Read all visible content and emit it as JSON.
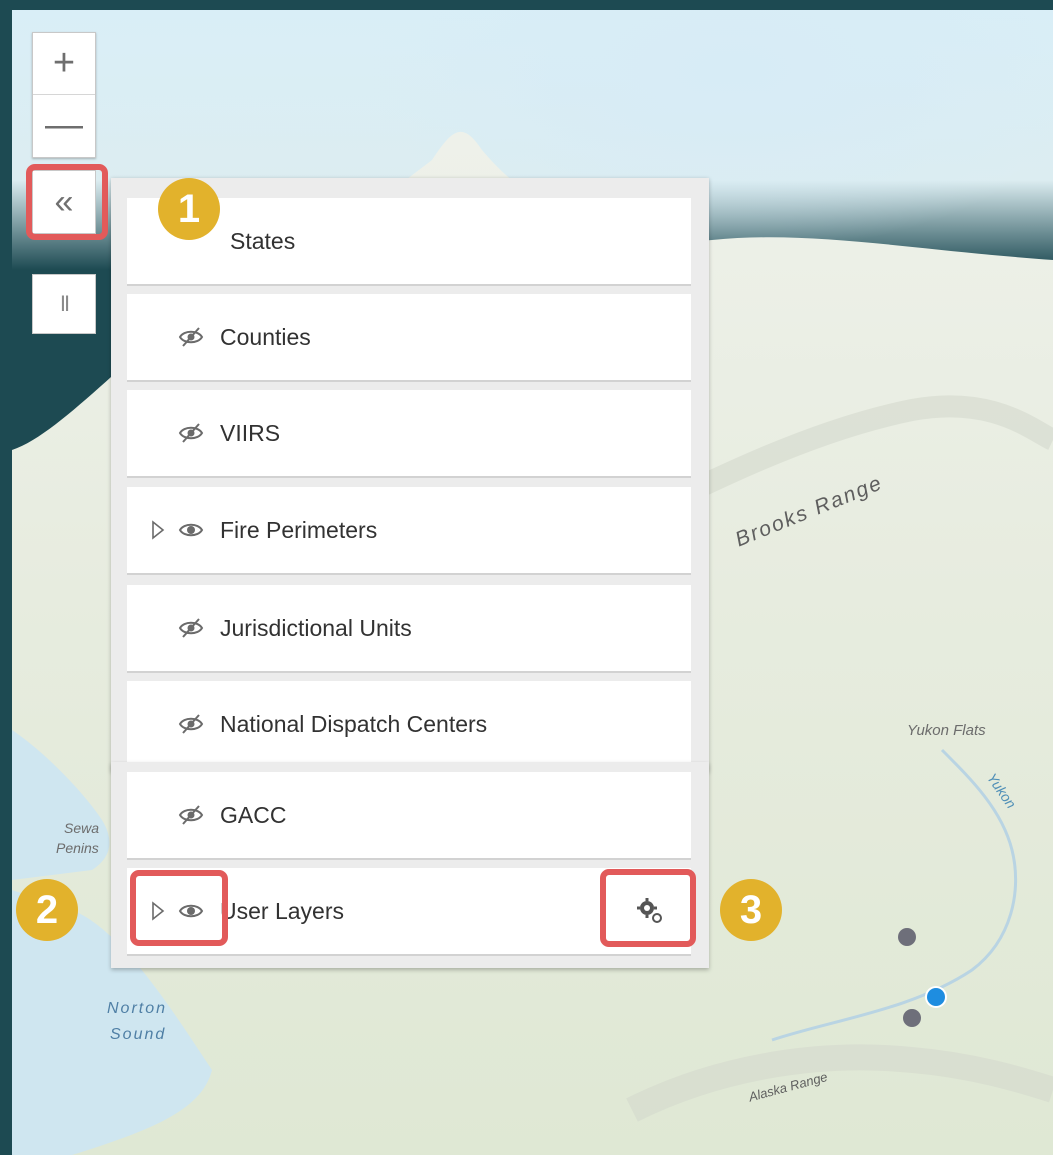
{
  "map": {
    "labels": {
      "brooks_range": "Brooks Range",
      "yukon_flats": "Yukon Flats",
      "yukon_river": "Yukon",
      "seward_1": "Sewa",
      "seward_2": "Penins",
      "norton_1": "Norton",
      "norton_2": "Sound",
      "alaska_range": "Alaska Range"
    },
    "colors": {
      "gray_dot": "#6e6f7a",
      "blue_dot": "#1e8de0"
    }
  },
  "controls": {
    "zoom_in": "+",
    "zoom_out": "—",
    "collapse": "«",
    "pause": "II"
  },
  "layers": [
    {
      "label": "States",
      "icon": "eye-hidden-icon",
      "expandable": false
    },
    {
      "label": "Counties",
      "icon": "eye-hidden-icon",
      "expandable": false
    },
    {
      "label": "VIIRS",
      "icon": "eye-hidden-icon",
      "expandable": false
    },
    {
      "label": "Fire Perimeters",
      "icon": "eye-icon",
      "expandable": true
    },
    {
      "label": "Jurisdictional Units",
      "icon": "eye-hidden-icon",
      "expandable": false
    },
    {
      "label": "National Dispatch Centers",
      "icon": "eye-hidden-icon",
      "expandable": false
    },
    {
      "label": "GACC",
      "icon": "eye-hidden-icon",
      "expandable": false
    },
    {
      "label": "User Layers",
      "icon": "eye-icon",
      "expandable": true,
      "settings_icon": "gear-icon"
    }
  ],
  "callouts": {
    "one": "1",
    "two": "2",
    "three": "3"
  },
  "accent": {
    "highlight": "#e25a5a",
    "badge": "#e2b22c"
  }
}
